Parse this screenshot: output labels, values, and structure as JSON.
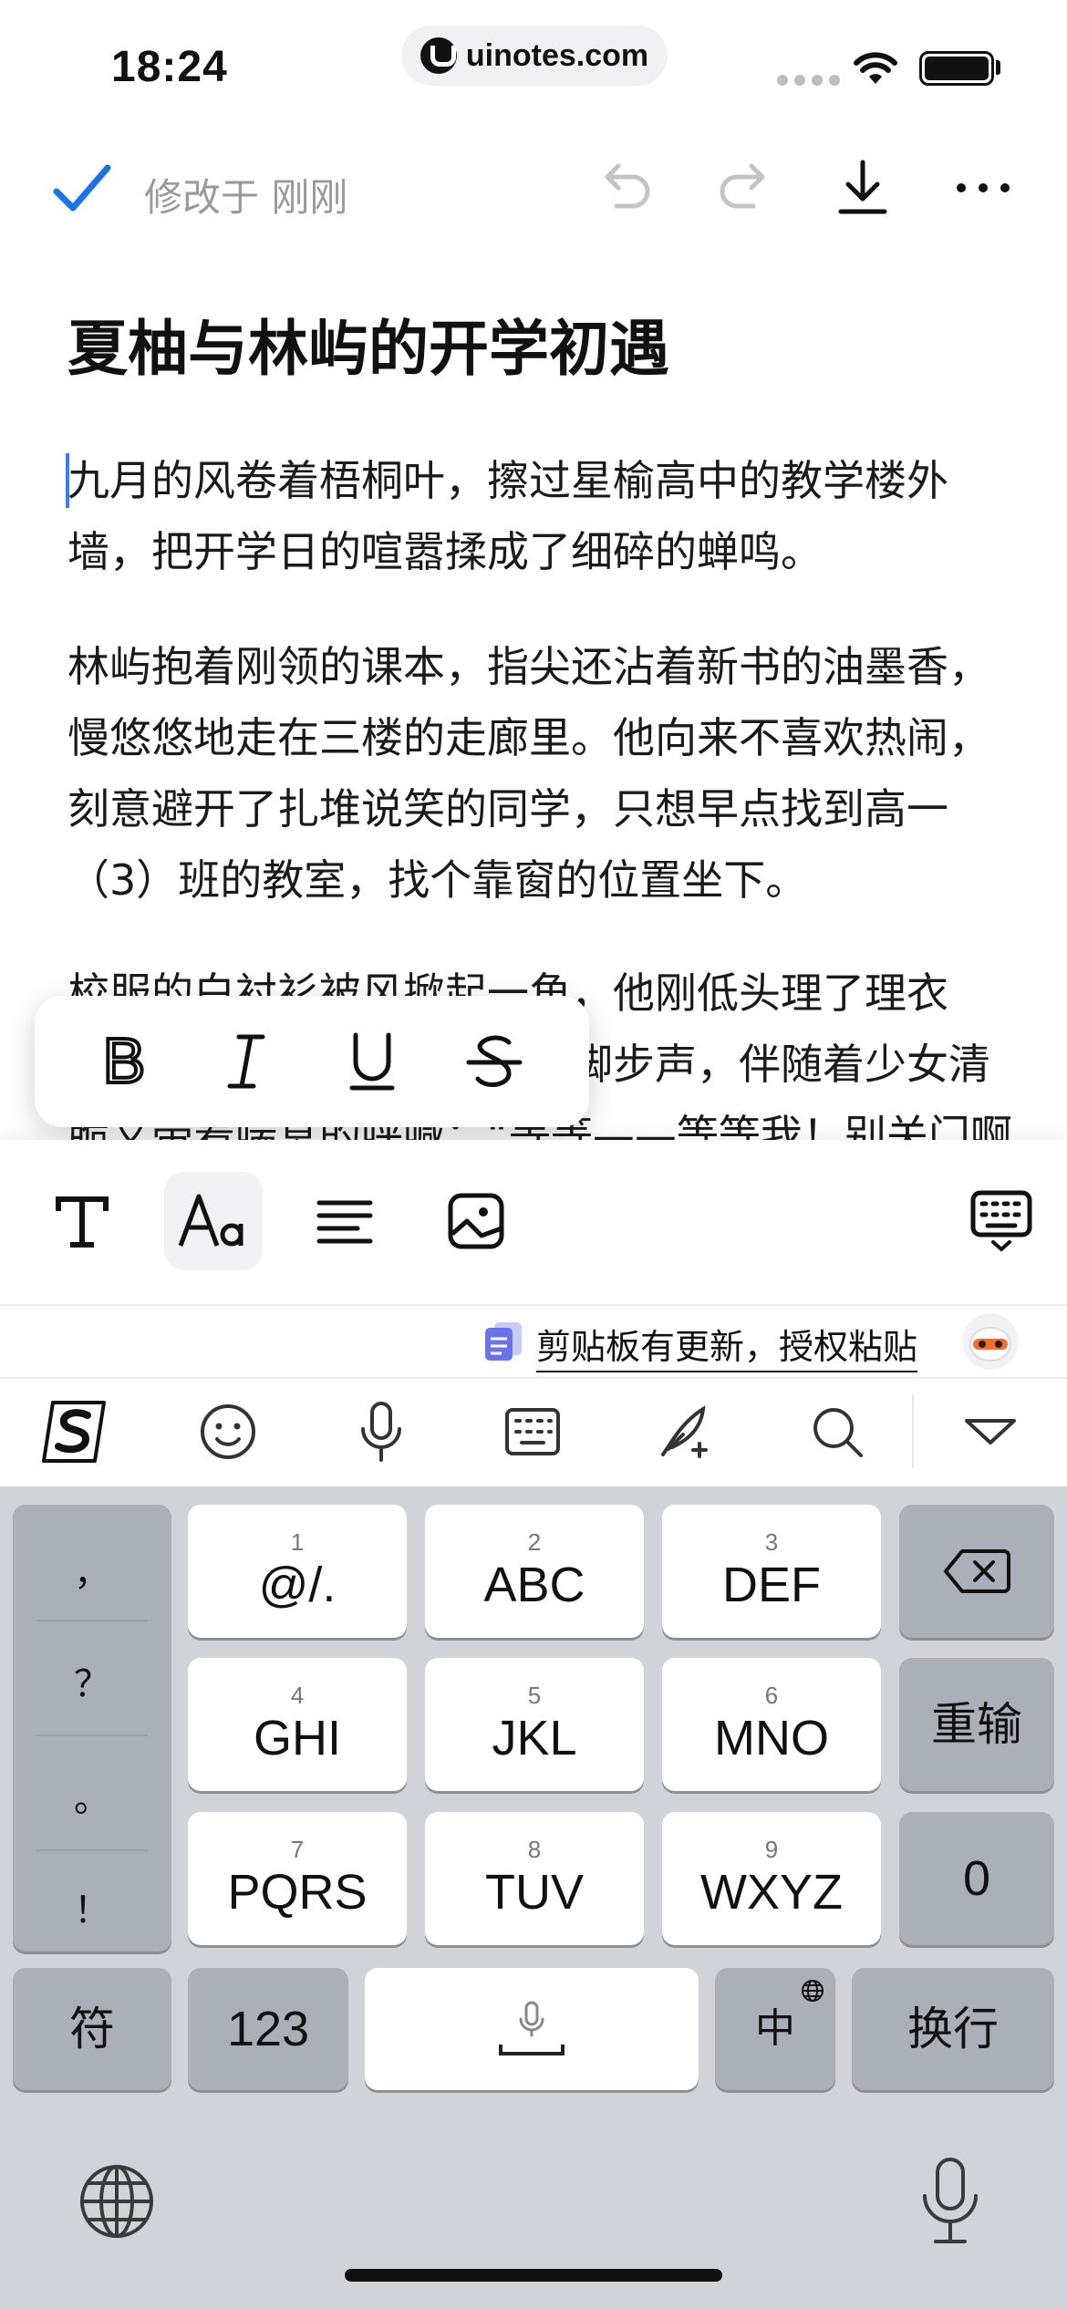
{
  "status_bar": {
    "time": "18:24",
    "site": "uinotes.com"
  },
  "toolbar": {
    "modified_text": "修改于 刚刚",
    "icons": [
      "check-icon",
      "undo-icon",
      "redo-icon",
      "download-icon",
      "more-icon"
    ]
  },
  "document": {
    "title": "夏柚与林屿的开学初遇",
    "paragraphs": [
      "九月的风卷着梧桐叶，擦过星榆高中的教学楼外墙，把开学日的喧嚣揉成了细碎的蝉鸣。",
      "林屿抱着刚领的课本，指尖还沾着新书的油墨香，慢悠悠地走在三楼的走廊里。他向来不喜欢热闹，刻意避开了扎堆说笑的同学，只想早点找到高一（3）班的教室，找个靠窗的位置坐下。",
      "校服的白衬衫被风掀起一角，他刚低头理了理衣角，身后就传来一阵急促的脚步声，伴随着少女清脆又带着喘息的呼喊：“等等——等等我！别关门啊"
    ]
  },
  "format_popup": {
    "bold": "B",
    "italic": "I",
    "underline": "U",
    "strikethrough": "S"
  },
  "bottom_tools": [
    "text-style-icon",
    "font-icon",
    "align-icon",
    "image-icon",
    "keyboard-icon"
  ],
  "clipboard": {
    "text": "剪贴板有更新，授权粘贴"
  },
  "keyboard": {
    "punctuation": [
      "，",
      "？",
      "。",
      "！"
    ],
    "rows": [
      [
        {
          "num": "1",
          "label": "@/."
        },
        {
          "num": "2",
          "label": "ABC"
        },
        {
          "num": "3",
          "label": "DEF"
        }
      ],
      [
        {
          "num": "4",
          "label": "GHI"
        },
        {
          "num": "5",
          "label": "JKL"
        },
        {
          "num": "6",
          "label": "MNO"
        }
      ],
      [
        {
          "num": "7",
          "label": "PQRS"
        },
        {
          "num": "8",
          "label": "TUV"
        },
        {
          "num": "9",
          "label": "WXYZ"
        }
      ]
    ],
    "reinput": "重输",
    "zero": "0",
    "symbols": "符",
    "numbers": "123",
    "lang": "中",
    "enter": "换行"
  },
  "colors": {
    "accent": "#3b7cf0",
    "keyboard_bg": "#d1d3d9",
    "key_dark": "#abafb8"
  }
}
